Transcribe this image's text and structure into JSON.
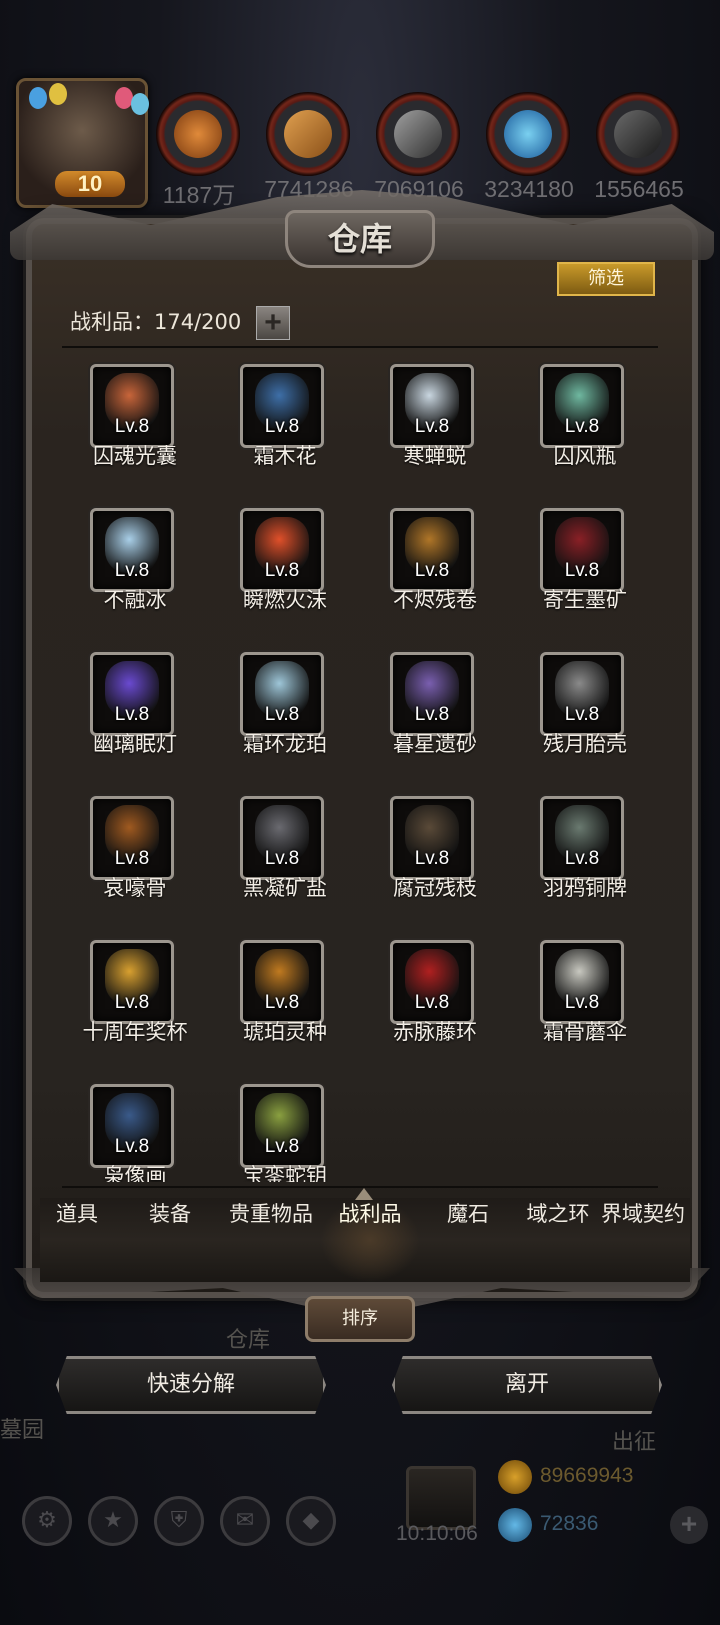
{
  "top_bar": {
    "avatar_level": "10",
    "resources": [
      {
        "icon": "meat-icon",
        "value": "1187万"
      },
      {
        "icon": "wood-icon",
        "value": "7741286"
      },
      {
        "icon": "iron-icon",
        "value": "7069106"
      },
      {
        "icon": "crystal-icon",
        "value": "3234180"
      },
      {
        "icon": "stone-icon",
        "value": "1556465"
      }
    ]
  },
  "panel": {
    "title": "仓库",
    "filter_label": "筛选",
    "count_label": "战利品：174/200",
    "plus_label": "+"
  },
  "items": [
    {
      "level": "Lv.8",
      "name": "囚魂光囊",
      "color": "#c8653a"
    },
    {
      "level": "Lv.8",
      "name": "霜木花",
      "color": "#3e6fa8"
    },
    {
      "level": "Lv.8",
      "name": "寒蝉蜕",
      "color": "#c9d6e0"
    },
    {
      "level": "Lv.8",
      "name": "囚风瓶",
      "color": "#6fb8a0"
    },
    {
      "level": "Lv.8",
      "name": "不融冰",
      "color": "#a9cfe8"
    },
    {
      "level": "Lv.8",
      "name": "瞬燃火沫",
      "color": "#e0502a"
    },
    {
      "level": "Lv.8",
      "name": "不烬残卷",
      "color": "#b07628"
    },
    {
      "level": "Lv.8",
      "name": "寄生墨矿",
      "color": "#8a2026"
    },
    {
      "level": "Lv.8",
      "name": "幽璃眠灯",
      "color": "#6a4ad0"
    },
    {
      "level": "Lv.8",
      "name": "霜环龙珀",
      "color": "#9ec6d8"
    },
    {
      "level": "Lv.8",
      "name": "暮星遗砂",
      "color": "#7a5fb0"
    },
    {
      "level": "Lv.8",
      "name": "残月胎壳",
      "color": "#8a8a8a"
    },
    {
      "level": "Lv.8",
      "name": "哀嚎骨",
      "color": "#a05a20"
    },
    {
      "level": "Lv.8",
      "name": "黑凝矿盐",
      "color": "#6a6a70"
    },
    {
      "level": "Lv.8",
      "name": "腐冠残枝",
      "color": "#5a4a38"
    },
    {
      "level": "Lv.8",
      "name": "羽鸦铜牌",
      "color": "#6a7a70"
    },
    {
      "level": "Lv.8",
      "name": "十周年奖杯",
      "color": "#d8a030"
    },
    {
      "level": "Lv.8",
      "name": "琥珀灵种",
      "color": "#c07a20"
    },
    {
      "level": "Lv.8",
      "name": "赤脉藤环",
      "color": "#b02020"
    },
    {
      "level": "Lv.8",
      "name": "霜骨蘑伞",
      "color": "#c8c8c0"
    },
    {
      "level": "Lv.8",
      "name": "枭像画",
      "color": "#3a5a8a"
    },
    {
      "level": "Lv.8",
      "name": "宝銮蛇钥",
      "color": "#8aa040"
    }
  ],
  "tabs": [
    {
      "label": "道具",
      "active": false
    },
    {
      "label": "装备",
      "active": false
    },
    {
      "label": "贵重物品",
      "active": false
    },
    {
      "label": "战利品",
      "active": true
    },
    {
      "label": "魔石",
      "active": false
    },
    {
      "label": "域之环",
      "active": false
    },
    {
      "label": "界域契约",
      "active": false
    }
  ],
  "sort_label": "排序",
  "background": {
    "warehouse_caption": "仓库",
    "cemetery_caption": "墓园",
    "expedition_caption": "出征"
  },
  "actions": {
    "quick_decompose": "快速分解",
    "leave": "离开"
  },
  "bottom_bar": {
    "timer": "10:10:06",
    "gold": "89669943",
    "gems": "72836",
    "add": "+"
  }
}
